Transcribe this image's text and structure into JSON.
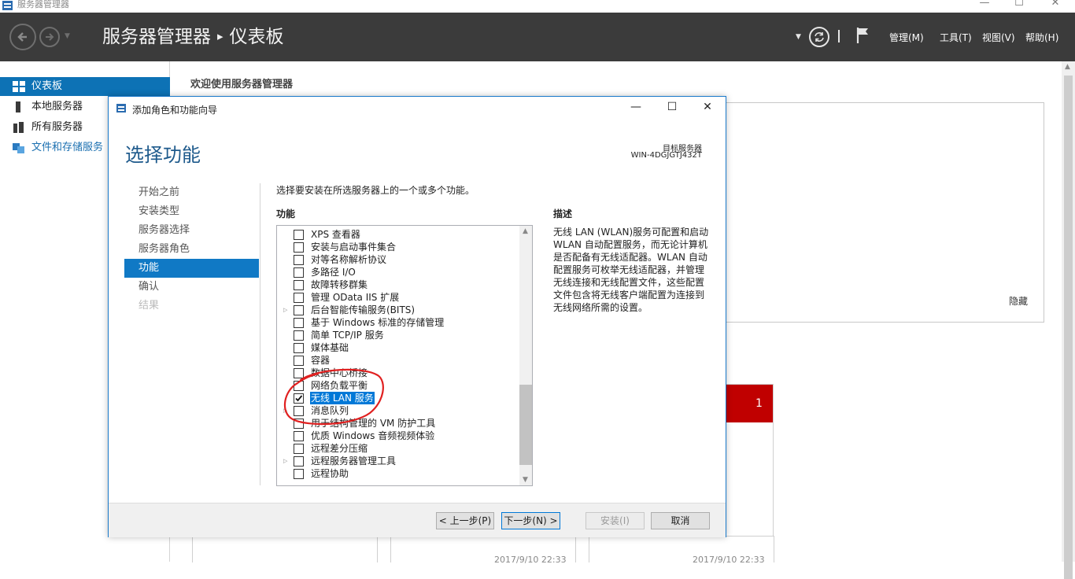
{
  "window": {
    "title": "服务器管理器",
    "controls": [
      "—",
      "☐",
      "✕"
    ]
  },
  "header": {
    "breadcrumb_root": "服务器管理器",
    "breadcrumb_sep": "▸",
    "breadcrumb_current": "仪表板",
    "menus": [
      "管理(M)",
      "工具(T)",
      "视图(V)",
      "帮助(H)"
    ]
  },
  "sidebar": {
    "items": [
      {
        "label": "仪表板",
        "icon": "dashboard-icon"
      },
      {
        "label": "本地服务器",
        "icon": "server-icon"
      },
      {
        "label": "所有服务器",
        "icon": "servers-icon"
      },
      {
        "label": "文件和存储服务",
        "icon": "storage-icon"
      }
    ]
  },
  "main": {
    "welcome": "欢迎使用服务器管理器",
    "hide": "隐藏",
    "tile_count": "1",
    "timestamps": [
      "2017/9/10 22:33",
      "2017/9/10 22:33"
    ]
  },
  "wizard": {
    "title": "添加角色和功能向导",
    "heading": "选择功能",
    "destination_label": "目标服务器",
    "destination_server": "WIN-4DGJGTJ432T",
    "steps": [
      {
        "label": "开始之前",
        "state": "normal"
      },
      {
        "label": "安装类型",
        "state": "normal"
      },
      {
        "label": "服务器选择",
        "state": "normal"
      },
      {
        "label": "服务器角色",
        "state": "normal"
      },
      {
        "label": "功能",
        "state": "active"
      },
      {
        "label": "确认",
        "state": "normal"
      },
      {
        "label": "结果",
        "state": "disabled"
      }
    ],
    "instruction": "选择要安装在所选服务器上的一个或多个功能。",
    "features_heading": "功能",
    "description_heading": "描述",
    "description": "无线 LAN (WLAN)服务可配置和启动 WLAN 自动配置服务，而无论计算机是否配备有无线适配器。WLAN 自动配置服务可枚举无线适配器，并管理无线连接和无线配置文件，这些配置文件包含将无线客户端配置为连接到无线网络所需的设置。",
    "features": [
      {
        "label": "XPS 查看器",
        "checked": false,
        "expandable": false,
        "selected": false
      },
      {
        "label": "安装与启动事件集合",
        "checked": false,
        "expandable": false,
        "selected": false
      },
      {
        "label": "对等名称解析协议",
        "checked": false,
        "expandable": false,
        "selected": false
      },
      {
        "label": "多路径 I/O",
        "checked": false,
        "expandable": false,
        "selected": false
      },
      {
        "label": "故障转移群集",
        "checked": false,
        "expandable": false,
        "selected": false
      },
      {
        "label": "管理 OData IIS 扩展",
        "checked": false,
        "expandable": false,
        "selected": false
      },
      {
        "label": "后台智能传输服务(BITS)",
        "checked": false,
        "expandable": true,
        "selected": false
      },
      {
        "label": "基于 Windows 标准的存储管理",
        "checked": false,
        "expandable": false,
        "selected": false
      },
      {
        "label": "简单 TCP/IP 服务",
        "checked": false,
        "expandable": false,
        "selected": false
      },
      {
        "label": "媒体基础",
        "checked": false,
        "expandable": false,
        "selected": false
      },
      {
        "label": "容器",
        "checked": false,
        "expandable": false,
        "selected": false
      },
      {
        "label": "数据中心桥接",
        "checked": false,
        "expandable": false,
        "selected": false
      },
      {
        "label": "网络负载平衡",
        "checked": false,
        "expandable": false,
        "selected": false
      },
      {
        "label": "无线 LAN 服务",
        "checked": true,
        "expandable": false,
        "selected": true
      },
      {
        "label": "消息队列",
        "checked": false,
        "expandable": true,
        "selected": false
      },
      {
        "label": "用于结构管理的 VM 防护工具",
        "checked": false,
        "expandable": false,
        "selected": false
      },
      {
        "label": "优质 Windows 音频视频体验",
        "checked": false,
        "expandable": false,
        "selected": false
      },
      {
        "label": "远程差分压缩",
        "checked": false,
        "expandable": false,
        "selected": false
      },
      {
        "label": "远程服务器管理工具",
        "checked": false,
        "expandable": true,
        "selected": false
      },
      {
        "label": "远程协助",
        "checked": false,
        "expandable": false,
        "selected": false
      }
    ],
    "buttons": {
      "prev": "< 上一步(P)",
      "next": "下一步(N) >",
      "install": "安装(I)",
      "cancel": "取消"
    }
  },
  "colors": {
    "header_bg": "#3b3b3b",
    "accent_blue": "#1079c5",
    "alert_red": "#c00000",
    "annotation_red": "#e02020"
  }
}
